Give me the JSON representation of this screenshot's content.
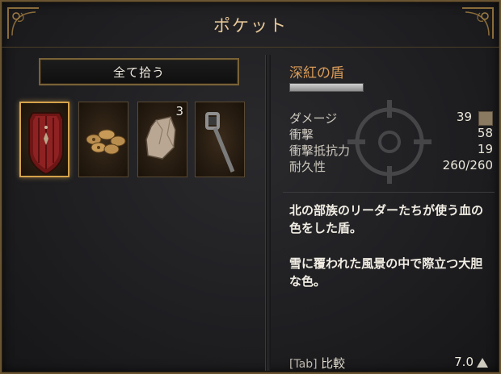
{
  "header": {
    "title": "ポケット"
  },
  "take_all_label": "全て拾う",
  "slots": [
    {
      "item": "crimson-shield",
      "selected": true,
      "count": ""
    },
    {
      "item": "cookies",
      "selected": false,
      "count": ""
    },
    {
      "item": "stone-chunk",
      "selected": false,
      "count": "3"
    },
    {
      "item": "iron-key",
      "selected": false,
      "count": ""
    }
  ],
  "detail": {
    "name": "深紅の盾",
    "stats": [
      {
        "label": "ダメージ",
        "value": "39"
      },
      {
        "label": "衝撃",
        "value": "58"
      },
      {
        "label": "衝撃抵抗力",
        "value": "19"
      },
      {
        "label": "耐久性",
        "value": "260/260"
      }
    ],
    "description": [
      "北の部族のリーダーたちが使う血の色をした盾。",
      "雪に覆われた風景の中で際立つ大胆な色。"
    ],
    "compare_key": "[Tab]",
    "compare_label": "比較",
    "weight": "7.0"
  },
  "colors": {
    "accent_gold": "#d4a24a",
    "item_name": "#d89b58",
    "title": "#e8c99a"
  }
}
